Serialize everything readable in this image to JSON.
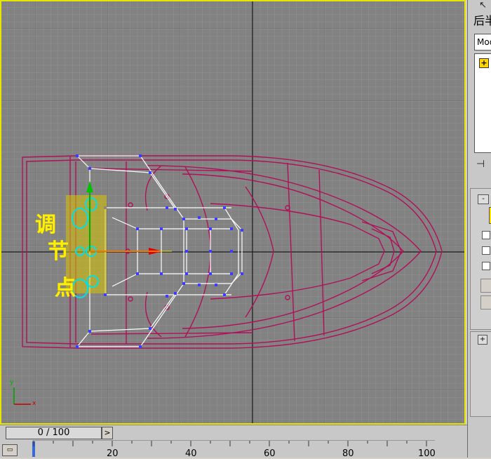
{
  "viewport": {
    "annotation_chars": [
      "调",
      "节",
      "点"
    ],
    "axis_labels": {
      "y": "y",
      "x": "x"
    }
  },
  "command_panel": {
    "tab_label": "后半",
    "modifier_field": "Mod",
    "icons": [
      "cursor-icon",
      "add-icon",
      "pin-icon",
      "minus-icon",
      "plus-icon"
    ]
  },
  "time_slider": {
    "frame_value": "0 / 100",
    "next_button": ">"
  },
  "track_bar": {
    "ticks": [
      "20",
      "40",
      "60",
      "80",
      "100"
    ]
  },
  "colors": {
    "viewport_bg": "#808080",
    "grid_line": "#9a9a9a",
    "hull_wire": "#b0105a",
    "selection_wire": "#ffffff",
    "vertex": "#3c3cff",
    "annotation": "#ffef00",
    "circle": "#00e0e8",
    "active_border": "#e6e600"
  }
}
